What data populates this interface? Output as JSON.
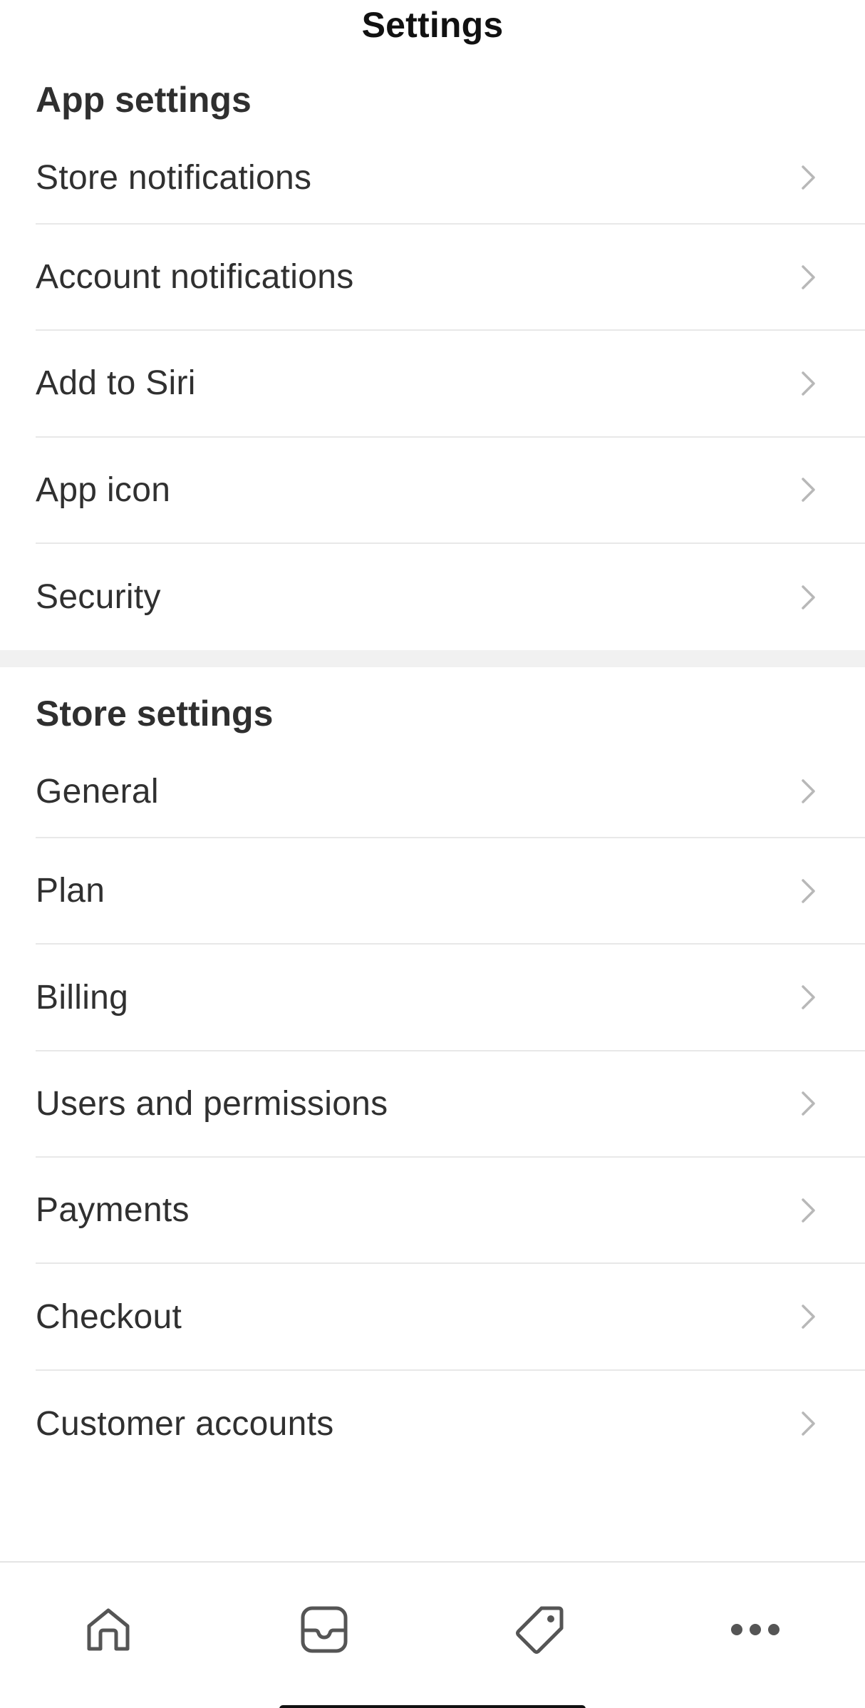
{
  "header": {
    "title": "Settings"
  },
  "app_settings": {
    "title": "App settings",
    "items": [
      {
        "label": "Store notifications"
      },
      {
        "label": "Account notifications"
      },
      {
        "label": "Add to Siri"
      },
      {
        "label": "App icon"
      },
      {
        "label": "Security"
      }
    ]
  },
  "store_settings": {
    "title": "Store settings",
    "items": [
      {
        "label": "General"
      },
      {
        "label": "Plan"
      },
      {
        "label": "Billing"
      },
      {
        "label": "Users and permissions"
      },
      {
        "label": "Payments"
      },
      {
        "label": "Checkout"
      },
      {
        "label": "Customer accounts"
      }
    ]
  },
  "tab_bar": {
    "tabs": [
      {
        "icon": "home-icon"
      },
      {
        "icon": "inbox-icon"
      },
      {
        "icon": "tag-icon"
      },
      {
        "icon": "more-icon"
      }
    ]
  },
  "colors": {
    "text": "#303030",
    "chevron": "#b8b8b8",
    "divider": "#e8e8e8",
    "section_gap": "#f1f1f1",
    "tab_icon": "#555555"
  }
}
